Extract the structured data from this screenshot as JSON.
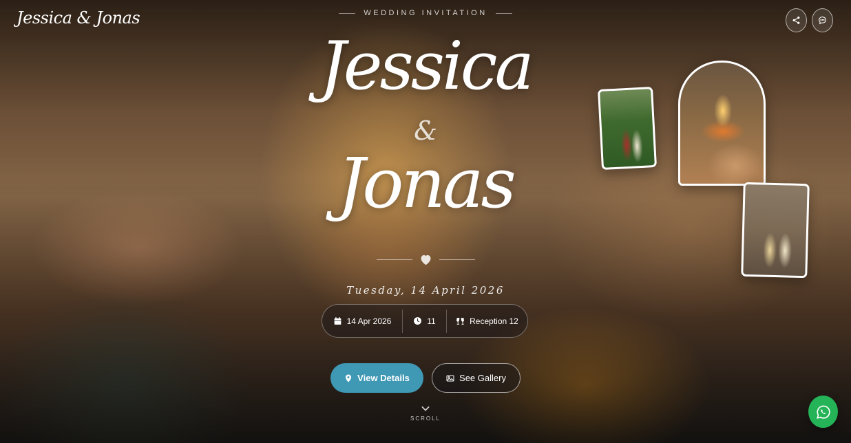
{
  "header": {
    "brand": "Jessica & Jonas",
    "share_icon": "share-icon",
    "message_icon": "chat-bubble-icon"
  },
  "hero": {
    "eyebrow": "WEDDING INVITATION",
    "name_1": "Jessica",
    "ampersand": "&",
    "name_2": "Jonas",
    "divider_icon": "heart-icon",
    "date_text": "Tuesday, 14 April 2026"
  },
  "info": {
    "date_label": "14 Apr 2026",
    "time_label": "11",
    "event_label": "Reception 12",
    "icons": [
      "calendar-icon",
      "clock-icon",
      "cheers-icon"
    ]
  },
  "actions": {
    "view_details_label": "View Details",
    "see_gallery_label": "See Gallery",
    "primary_color": "#3f98b4"
  },
  "scroll": {
    "label": "SCROLL"
  },
  "whatsapp": {
    "icon": "whatsapp-icon",
    "color": "#25b357"
  }
}
